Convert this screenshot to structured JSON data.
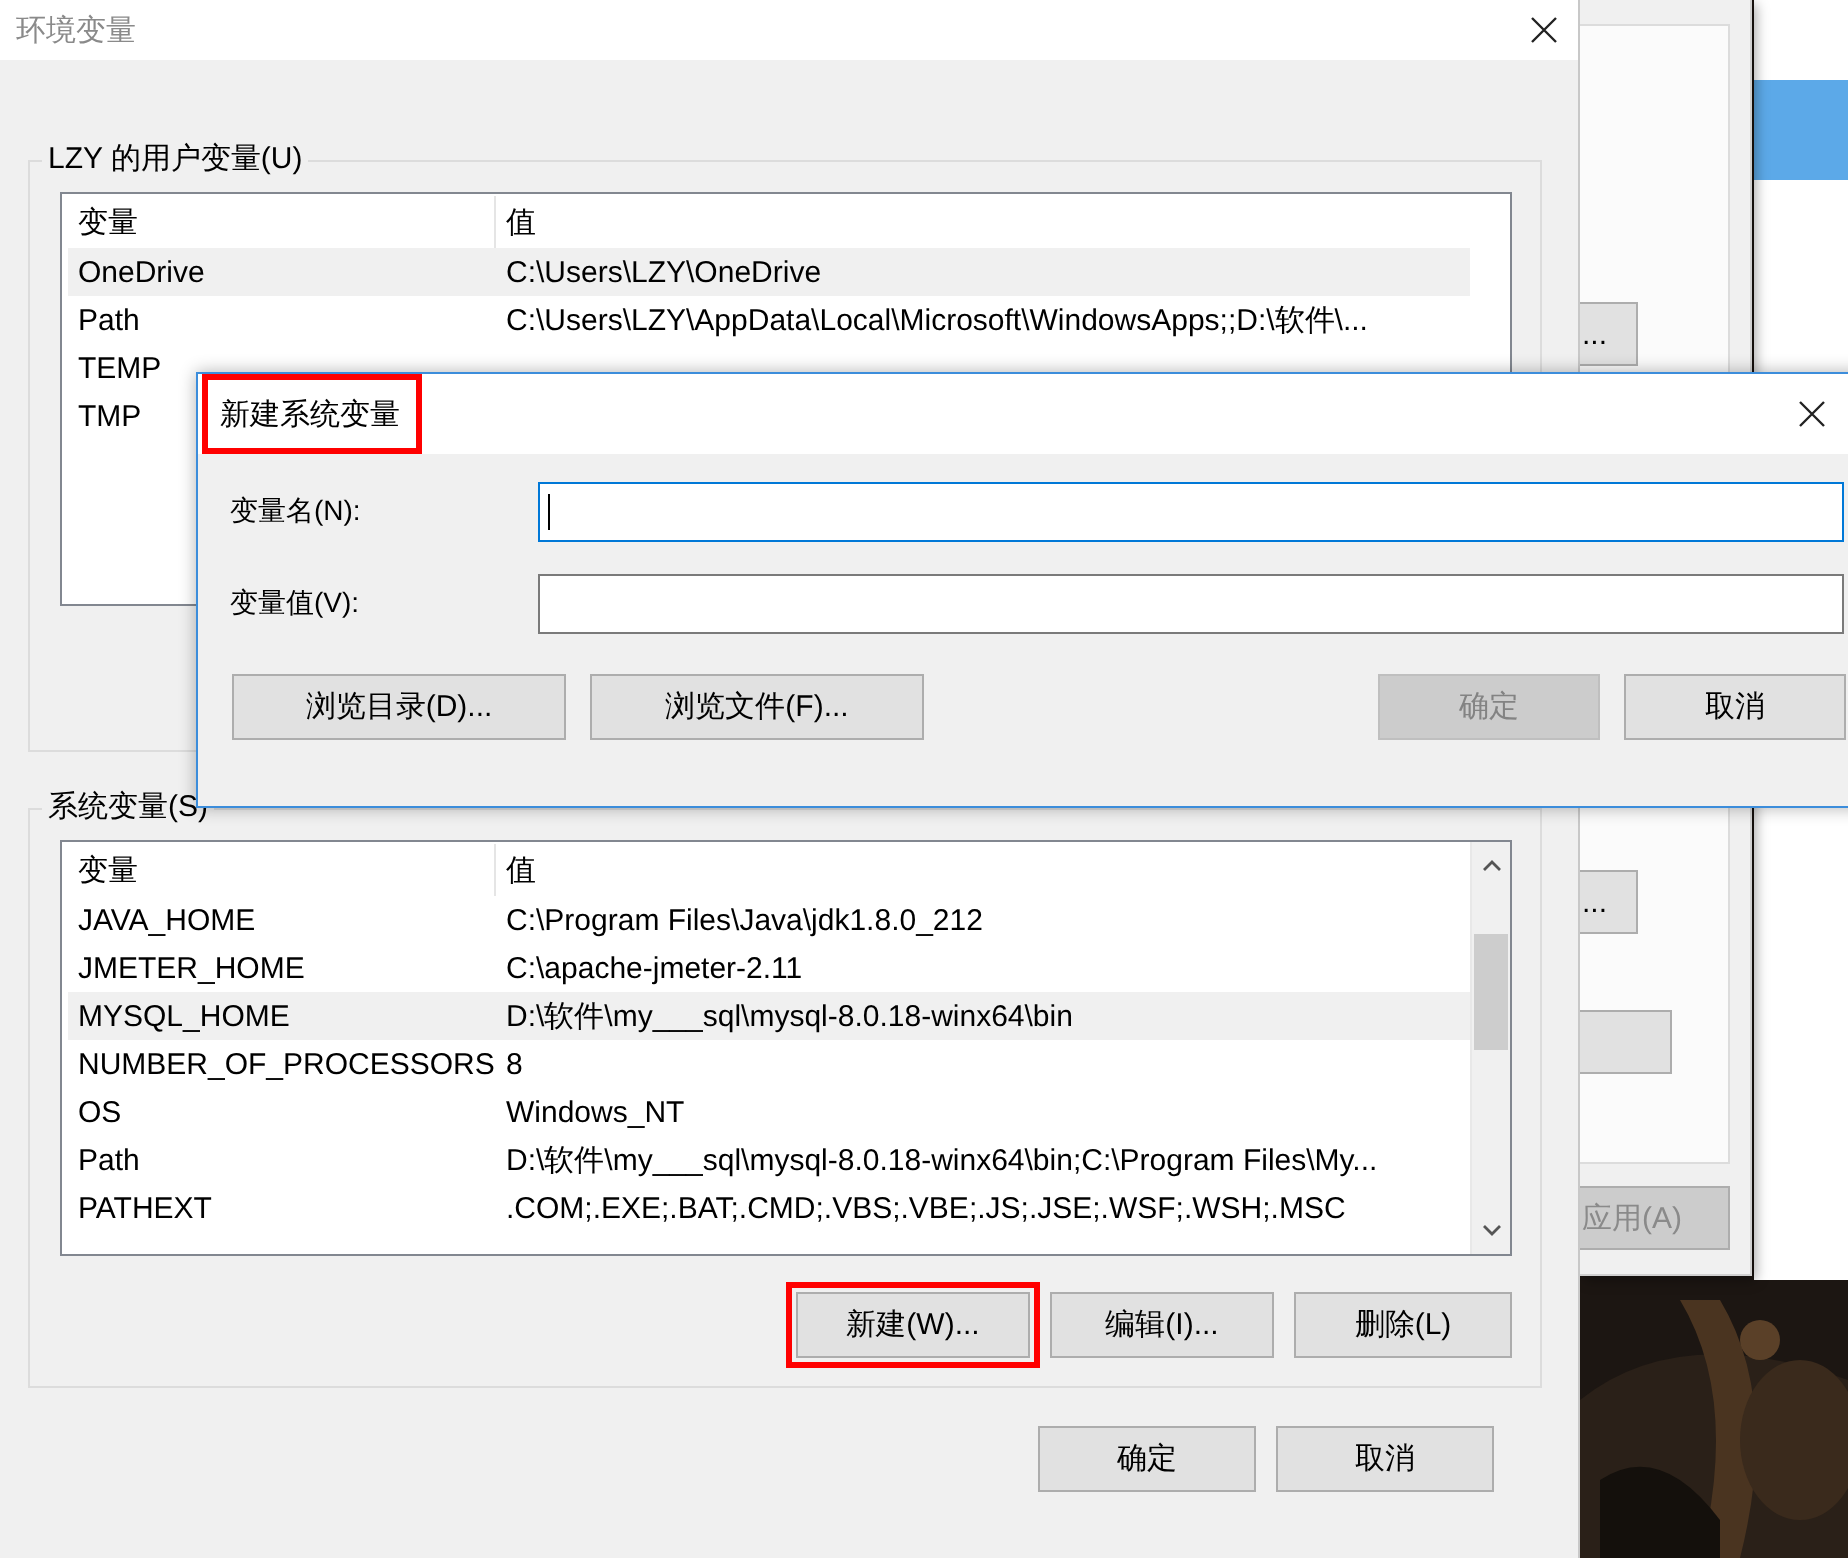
{
  "background_window": {
    "buttons": [
      {
        "label": "...",
        "disabled": false
      },
      {
        "label": "...",
        "disabled": false
      },
      {
        "disabled": false
      },
      {
        "label": "应用(A)",
        "disabled": true
      }
    ]
  },
  "env_window": {
    "title": "环境变量",
    "user_group": {
      "label": "LZY 的用户变量(U)",
      "columns": [
        "变量",
        "值"
      ],
      "rows": [
        {
          "name": "OneDrive",
          "value": "C:\\Users\\LZY\\OneDrive",
          "selected": true
        },
        {
          "name": "Path",
          "value": "C:\\Users\\LZY\\AppData\\Local\\Microsoft\\WindowsApps;;D:\\软件\\...",
          "selected": false
        },
        {
          "name": "TEMP",
          "selected": false
        },
        {
          "name": "TMP",
          "selected": false
        }
      ]
    },
    "system_group": {
      "label": "系统变量(S)",
      "columns": [
        "变量",
        "值"
      ],
      "rows": [
        {
          "name": "JAVA_HOME",
          "value": "C:\\Program Files\\Java\\jdk1.8.0_212",
          "selected": false
        },
        {
          "name": "JMETER_HOME",
          "value": "C:\\apache-jmeter-2.11",
          "selected": false
        },
        {
          "name": "MYSQL_HOME",
          "value": "D:\\软件\\my___sql\\mysql-8.0.18-winx64\\bin",
          "selected": true
        },
        {
          "name": "NUMBER_OF_PROCESSORS",
          "value": "8",
          "selected": false
        },
        {
          "name": "OS",
          "value": "Windows_NT",
          "selected": false
        },
        {
          "name": "Path",
          "value": "D:\\软件\\my___sql\\mysql-8.0.18-winx64\\bin;C:\\Program Files\\My...",
          "selected": false
        },
        {
          "name": "PATHEXT",
          "value": ".COM;.EXE;.BAT;.CMD;.VBS;.VBE;.JS;.JSE;.WSF;.WSH;.MSC",
          "selected": false
        }
      ],
      "buttons": [
        {
          "label": "新建(W)...",
          "highlighted": true
        },
        {
          "label": "编辑(I)...",
          "highlighted": false
        },
        {
          "label": "删除(L)",
          "highlighted": false
        }
      ]
    },
    "buttons": [
      "确定",
      "取消"
    ]
  },
  "new_dialog": {
    "title": "新建系统变量",
    "title_highlighted": true,
    "fields": [
      {
        "label": "变量名(N):",
        "focused": true
      },
      {
        "label": "变量值(V):",
        "focused": false
      }
    ],
    "buttons": [
      {
        "label": "浏览目录(D)...",
        "disabled": false
      },
      {
        "label": "浏览文件(F)...",
        "disabled": false
      },
      {
        "label": "确定",
        "disabled": true
      },
      {
        "label": "取消",
        "disabled": false
      }
    ]
  }
}
